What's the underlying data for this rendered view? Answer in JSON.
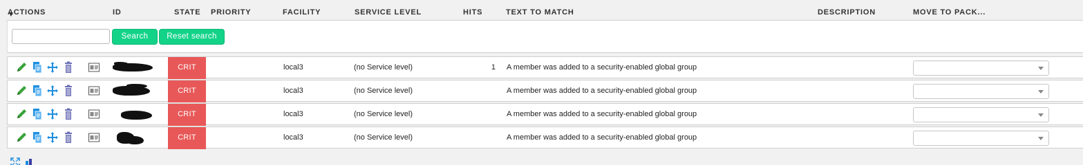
{
  "header": {
    "actions": "ACTIONS",
    "id": "ID",
    "state": "STATE",
    "priority": "PRIORITY",
    "facility": "FACILITY",
    "service_level": "SERVICE LEVEL",
    "hits": "HITS",
    "text_to_match": "TEXT TO MATCH",
    "description": "DESCRIPTION",
    "move_to_pack": "MOVE TO PACK..."
  },
  "filter": {
    "search_value": "",
    "search_label": "Search",
    "reset_label": "Reset search"
  },
  "rows": [
    {
      "id": "",
      "state": "CRIT",
      "priority": "",
      "facility": "local3",
      "service_level": "(no Service level)",
      "hits": "1",
      "text_to_match": "A member was added to a security-enabled global group",
      "description": "",
      "move_to_pack": ""
    },
    {
      "id": "",
      "state": "CRIT",
      "priority": "",
      "facility": "local3",
      "service_level": "(no Service level)",
      "hits": "",
      "text_to_match": "A member was added to a security-enabled global group",
      "description": "",
      "move_to_pack": ""
    },
    {
      "id": "",
      "state": "CRIT",
      "priority": "",
      "facility": "local3",
      "service_level": "(no Service level)",
      "hits": "",
      "text_to_match": "A member was added to a security-enabled global group",
      "description": "",
      "move_to_pack": ""
    },
    {
      "id": "",
      "state": "CRIT",
      "priority": "",
      "facility": "local3",
      "service_level": "(no Service level)",
      "hits": "",
      "text_to_match": "A member was added to a security-enabled global group",
      "description": "",
      "move_to_pack": ""
    }
  ],
  "colors": {
    "crit": "#e85858",
    "button": "#13d389",
    "edit_icon": "#3aa33a",
    "move_icon": "#1e8fe0",
    "delete_icon": "#6a6fb5"
  },
  "icons": {
    "sort": "triangle-down",
    "row_actions": [
      "edit-icon",
      "clone-icon",
      "move-icon",
      "delete-icon",
      "simulate-icon"
    ],
    "footer": [
      "expand-icon",
      "bar-icon"
    ]
  }
}
